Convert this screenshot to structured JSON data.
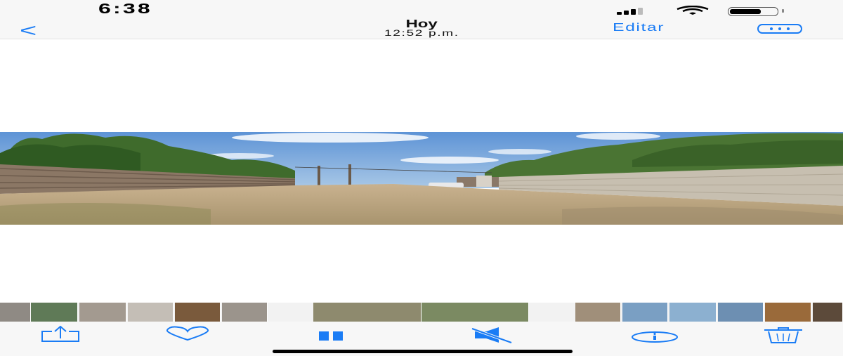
{
  "status_bar": {
    "time": "6:38",
    "icons": [
      "signal-icon",
      "wifi-icon",
      "battery-icon"
    ]
  },
  "nav": {
    "back_icon": "chevron-left-icon",
    "back_glyph": "<",
    "title": "Hoy",
    "subtitle": "12:52 p.m.",
    "edit_label": "Editar",
    "more_icon": "more-icon"
  },
  "thumbnails": [
    {
      "color": "#8f8a84"
    },
    {
      "color": "#5f7a57"
    },
    {
      "color": "#a39a90"
    },
    {
      "color": "#c4beb6"
    },
    {
      "color": "#7a5a3c"
    },
    {
      "color": "#9b948c"
    },
    {
      "color": "#8e8a6e"
    },
    {
      "color": "#7b8a62"
    },
    {
      "color": "#a08f7a"
    },
    {
      "color": "#7a9fc3"
    },
    {
      "color": "#8cb0d0"
    },
    {
      "color": "#6d8fb2"
    },
    {
      "color": "#9a6a3a"
    },
    {
      "color": "#5c4a3a"
    },
    {
      "color": "#7a6a5a"
    }
  ],
  "toolbar": {
    "icons": [
      "share-icon",
      "heart-icon",
      "pause-icon",
      "mute-icon",
      "info-icon",
      "trash-icon"
    ]
  },
  "colors": {
    "accent": "#1a7cf5",
    "bar_background": "#f7f7f7"
  }
}
